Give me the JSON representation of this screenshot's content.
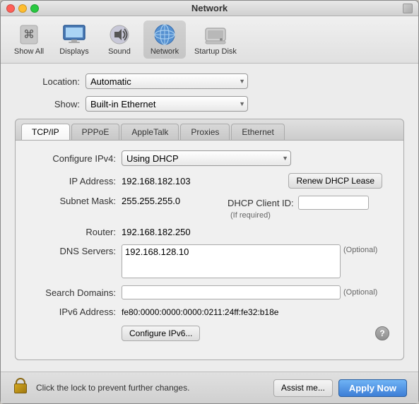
{
  "window": {
    "title": "Network"
  },
  "toolbar": {
    "items": [
      {
        "id": "show-all",
        "label": "Show All",
        "icon": "apple"
      },
      {
        "id": "displays",
        "label": "Displays",
        "icon": "displays"
      },
      {
        "id": "sound",
        "label": "Sound",
        "icon": "sound"
      },
      {
        "id": "network",
        "label": "Network",
        "icon": "network"
      },
      {
        "id": "startup-disk",
        "label": "Startup Disk",
        "icon": "startup-disk"
      }
    ]
  },
  "location": {
    "label": "Location:",
    "value": "Automatic"
  },
  "show": {
    "label": "Show:",
    "value": "Built-in Ethernet"
  },
  "tabs": {
    "items": [
      {
        "id": "tcp-ip",
        "label": "TCP/IP",
        "active": true
      },
      {
        "id": "pppoe",
        "label": "PPPoE",
        "active": false
      },
      {
        "id": "appletalk",
        "label": "AppleTalk",
        "active": false
      },
      {
        "id": "proxies",
        "label": "Proxies",
        "active": false
      },
      {
        "id": "ethernet",
        "label": "Ethernet",
        "active": false
      }
    ]
  },
  "fields": {
    "configure_label": "Configure IPv4:",
    "configure_value": "Using DHCP",
    "ip_label": "IP Address:",
    "ip_value": "192.168.182.103",
    "subnet_label": "Subnet Mask:",
    "subnet_value": "255.255.255.0",
    "dhcp_client_label": "DHCP Client ID:",
    "dhcp_client_placeholder": "",
    "if_required": "(If required)",
    "router_label": "Router:",
    "router_value": "192.168.182.250",
    "dns_label": "DNS Servers:",
    "dns_value": "192.168.128.10",
    "dns_optional": "(Optional)",
    "search_label": "Search Domains:",
    "search_optional": "(Optional)",
    "ipv6_label": "IPv6 Address:",
    "ipv6_value": "fe80:0000:0000:0000:0211:24ff:fe32:b18e"
  },
  "buttons": {
    "renew_dhcp": "Renew DHCP Lease",
    "configure_ipv6": "Configure IPv6...",
    "assist_me": "Assist me...",
    "apply_now": "Apply Now"
  },
  "bottom": {
    "lock_text": "Click the lock to prevent further changes."
  }
}
